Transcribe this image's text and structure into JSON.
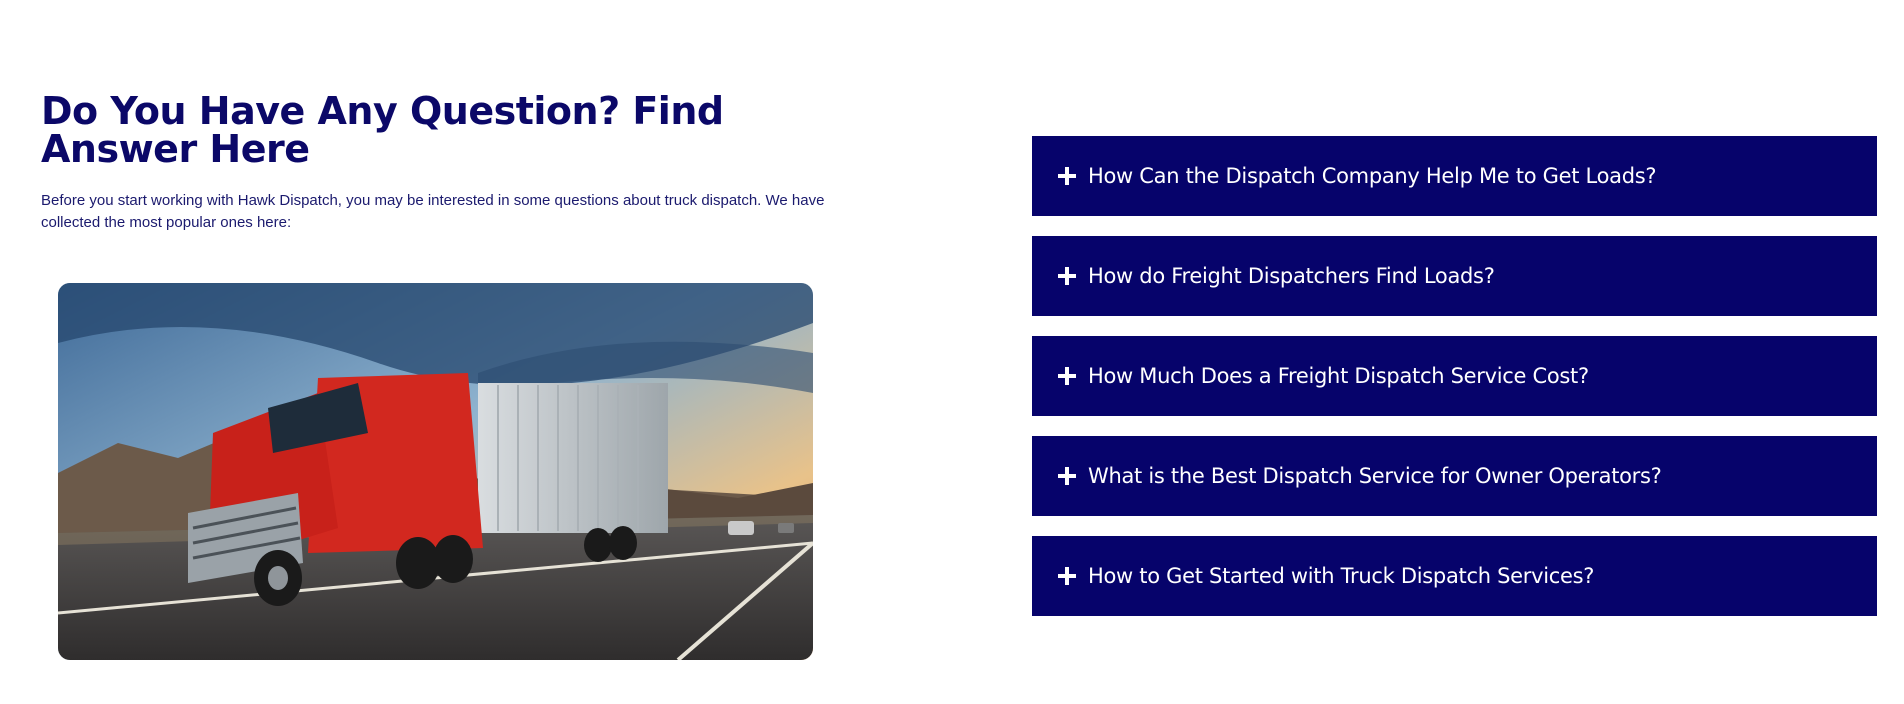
{
  "section": {
    "title": "Do You Have Any Question? Find Answer Here",
    "description": "Before you start working with Hawk Dispatch, you may be interested in some questions about truck dispatch. We have collected the most popular ones here:"
  },
  "image": {
    "subject": "red semi truck on highway at sunset"
  },
  "faq": {
    "icon": "plus-icon",
    "items": [
      {
        "question": "How Can the Dispatch Company Help Me to Get Loads?"
      },
      {
        "question": "How do Freight Dispatchers Find Loads?"
      },
      {
        "question": "How Much Does a Freight Dispatch Service Cost?"
      },
      {
        "question": "What is the Best Dispatch Service for Owner Operators?"
      },
      {
        "question": "How to Get Started with Truck Dispatch Services?"
      }
    ]
  },
  "colors": {
    "heading": "#0b0868",
    "accordion_bg": "#06036b",
    "accordion_text": "#ffffff"
  }
}
